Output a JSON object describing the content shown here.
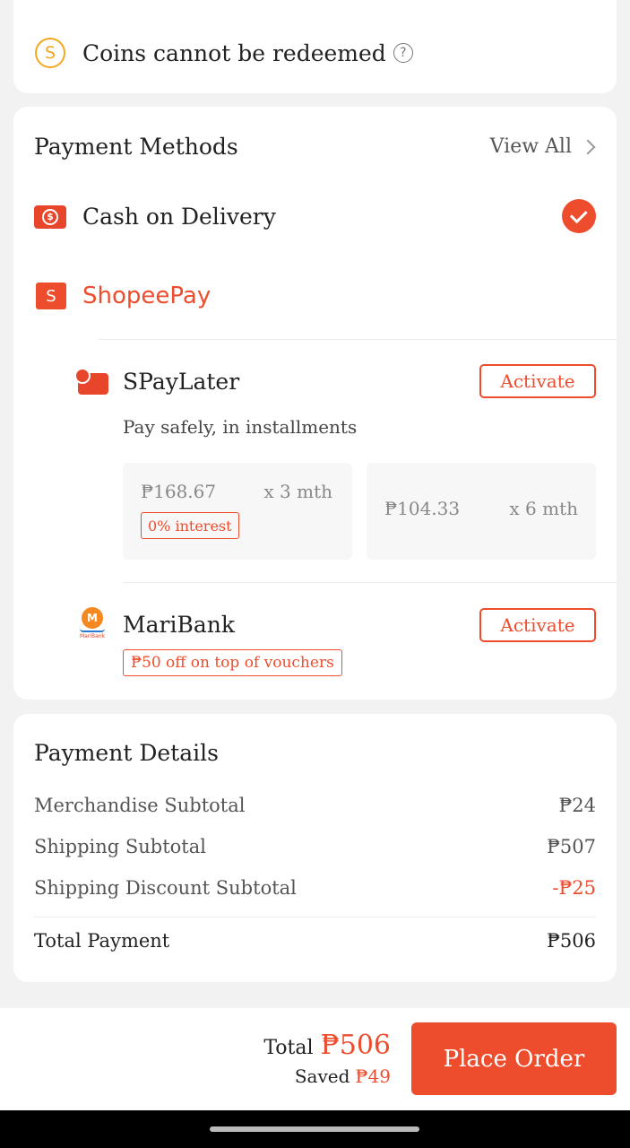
{
  "coins": {
    "text": "Coins cannot be redeemed",
    "coin_symbol": "S",
    "help_symbol": "?"
  },
  "payment_methods": {
    "title": "Payment Methods",
    "view_all": "View All",
    "cod": {
      "label": "Cash on Delivery",
      "selected": true
    },
    "shopeepay": {
      "label": "ShopeePay",
      "icon_letter": "S"
    },
    "spaylater": {
      "title": "SPayLater",
      "subtitle": "Pay safely, in installments",
      "button": "Activate",
      "plans": [
        {
          "amount": "₱168.67",
          "term": "x 3 mth",
          "badge": "0% interest"
        },
        {
          "amount": "₱104.33",
          "term": "x 6 mth"
        }
      ]
    },
    "maribank": {
      "title": "MariBank",
      "button": "Activate",
      "tag": "₱50 off on top of vouchers",
      "icon_letter": "M",
      "icon_text": "MariBank"
    }
  },
  "payment_details": {
    "title": "Payment Details",
    "rows": [
      {
        "label": "Merchandise Subtotal",
        "value": "₱24"
      },
      {
        "label": "Shipping Subtotal",
        "value": "₱507"
      },
      {
        "label": "Shipping Discount Subtotal",
        "value": "-₱25"
      }
    ],
    "total": {
      "label": "Total Payment",
      "value": "₱506"
    }
  },
  "footer": {
    "total_label": "Total",
    "total_value": "₱506",
    "saved_label": "Saved",
    "saved_value": "₱49",
    "button": "Place Order"
  },
  "colors": {
    "accent": "#ee4d2d",
    "coin": "#f2a81c"
  }
}
